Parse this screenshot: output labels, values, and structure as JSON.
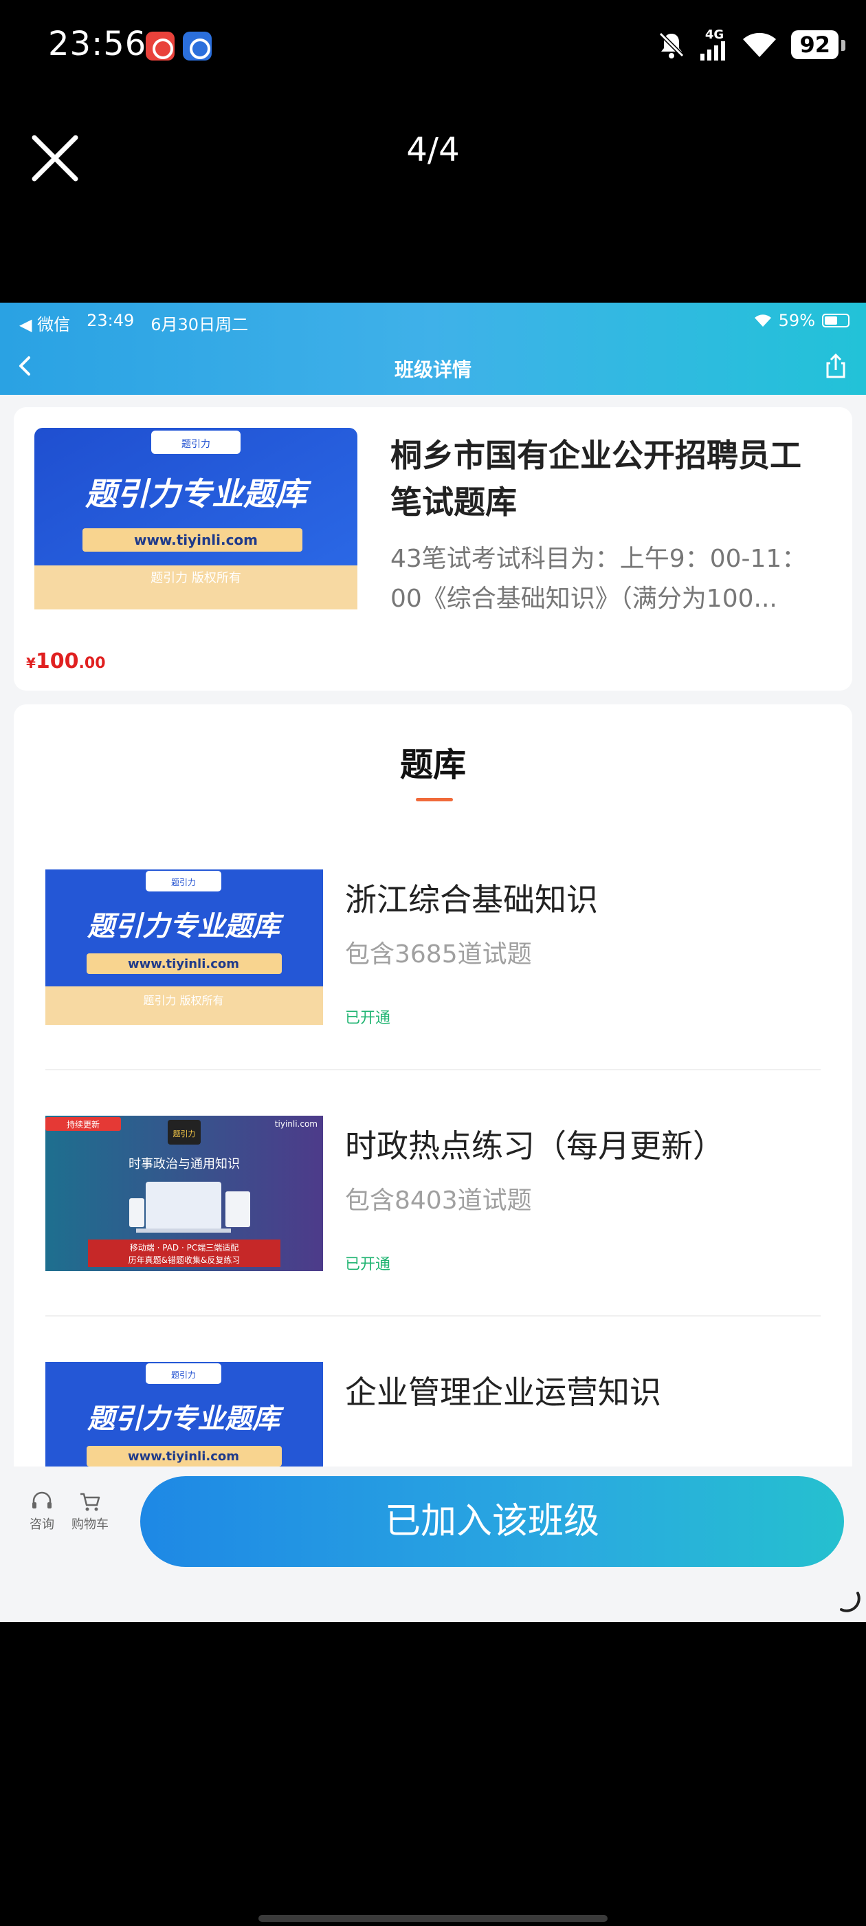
{
  "status_bar": {
    "time": "23:56",
    "network": "4G",
    "battery": "92",
    "icons": [
      "bell-muted-icon",
      "signal-icon",
      "wifi-icon",
      "battery-icon"
    ]
  },
  "viewer": {
    "counter": "4/4",
    "close_icon": "close-icon"
  },
  "inner_status": {
    "app": "◀ 微信",
    "time": "23:49",
    "date": "6月30日周二",
    "battery": "59%"
  },
  "inner_nav": {
    "title": "班级详情"
  },
  "course": {
    "title": "桐乡市国有企业公开招聘员工笔试题库",
    "description": "43笔试考试科目为：上午9：00-11：00《综合基础知识》（满分为100...",
    "price_currency": "¥",
    "price_int": "100",
    "price_dec": ".00",
    "thumb": {
      "brand": "题引力",
      "headline": "题引力专业题库",
      "url": "www.tiyinli.com",
      "copyright": "题引力 版权所有"
    }
  },
  "bank": {
    "heading": "题库",
    "items": [
      {
        "title": "浙江综合基础知识",
        "count": "包含3685道试题",
        "status": "已开通"
      },
      {
        "title": "时政热点练习（每月更新）",
        "count": "包含8403道试题",
        "status": "已开通"
      },
      {
        "title": "企业管理企业运营知识",
        "count": "",
        "status": ""
      }
    ],
    "news_thumb": {
      "tag": "持续更新",
      "site": "tiyinli.com",
      "logo": "题引力",
      "headline": "时事政治与通用知识",
      "line1": "移动端 · PAD · PC端三端适配",
      "line2": "历年真题&错题收集&反复练习"
    }
  },
  "bottom_bar": {
    "consult_label": "咨询",
    "cart_label": "购物车",
    "join_label": "已加入该班级"
  },
  "colors": {
    "header_gradient": [
      "#2aa2e3",
      "#22c2d8"
    ],
    "price": "#e02020",
    "opened": "#22b573",
    "accent_underline": "#f06a3a"
  }
}
